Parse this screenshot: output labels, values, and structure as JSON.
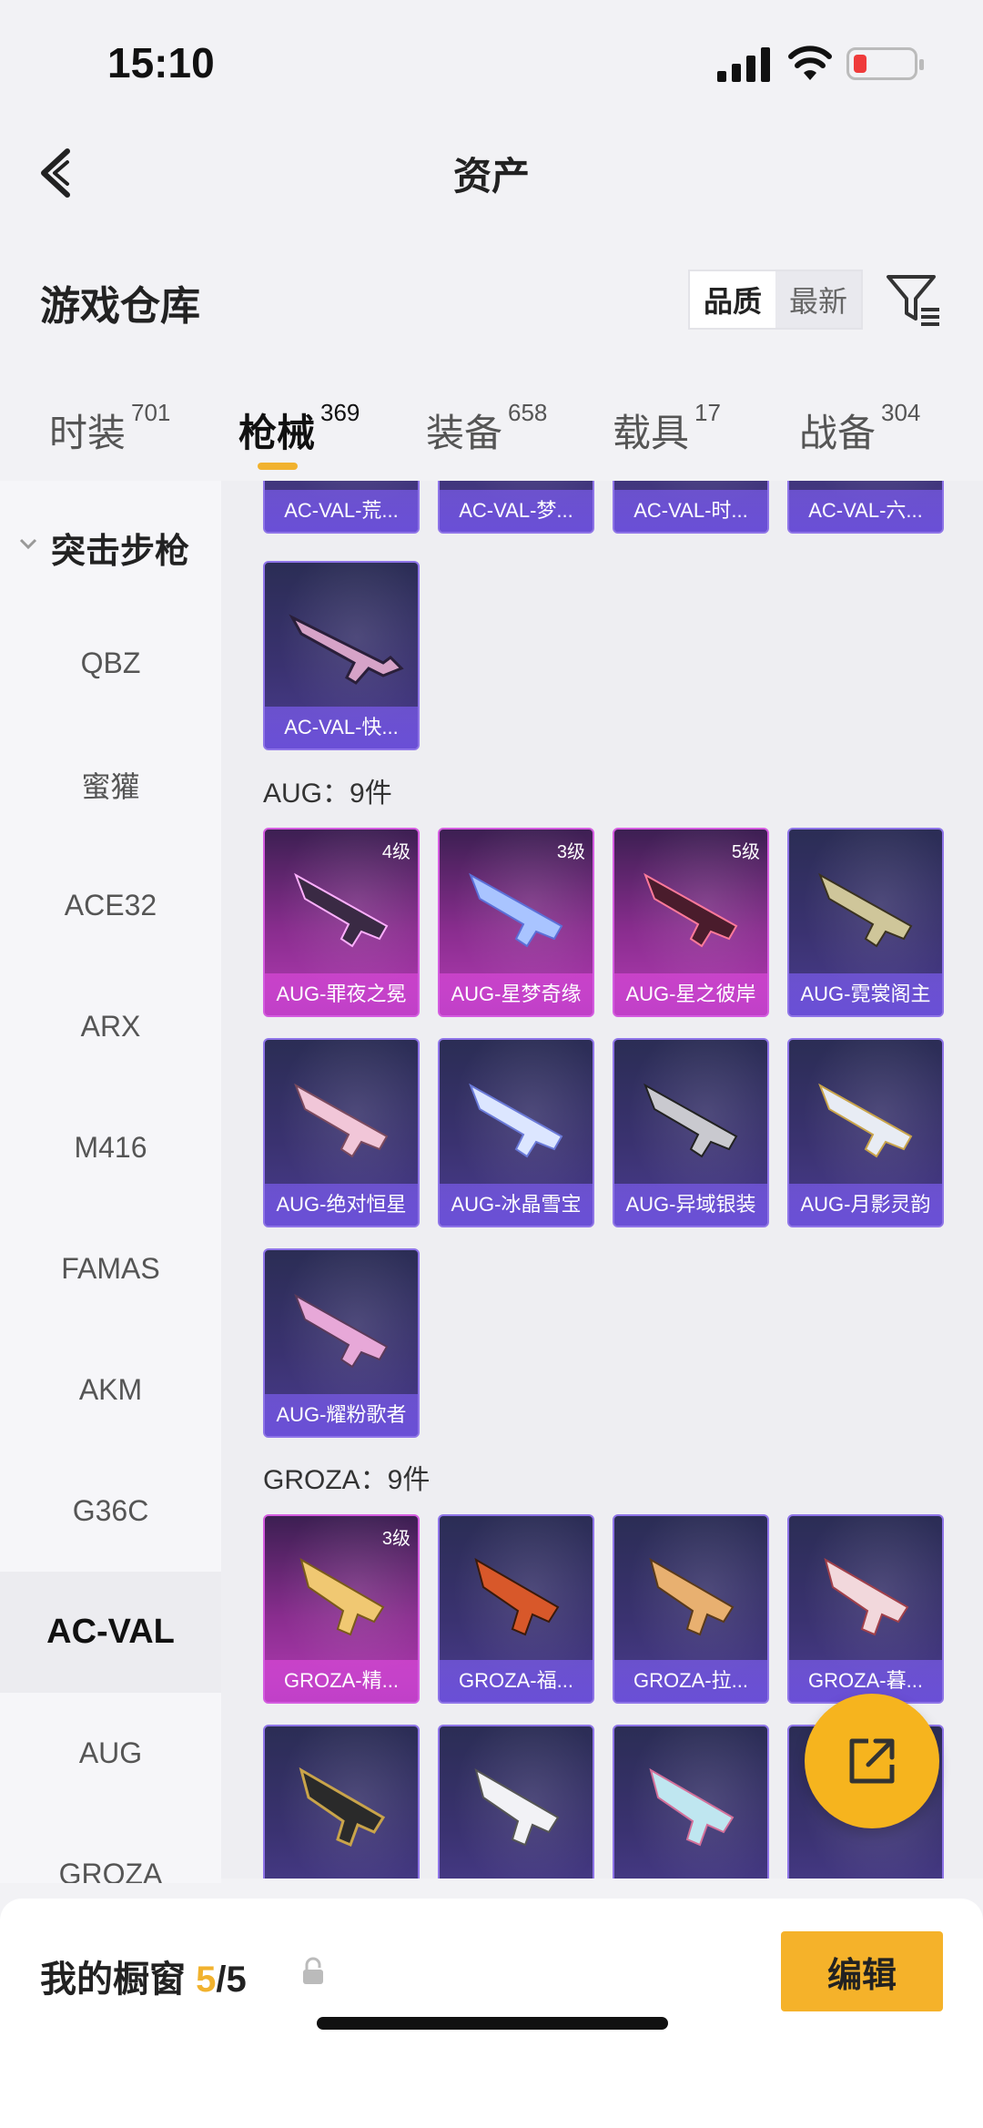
{
  "status_bar": {
    "time": "15:10"
  },
  "nav": {
    "title": "资产"
  },
  "warehouse": {
    "title": "游戏仓库",
    "sort_options": [
      "品质",
      "最新"
    ],
    "sort_selected": "品质"
  },
  "tabs": [
    {
      "label": "时装",
      "count": "701"
    },
    {
      "label": "枪械",
      "count": "369",
      "active": true
    },
    {
      "label": "装备",
      "count": "658"
    },
    {
      "label": "载具",
      "count": "17"
    },
    {
      "label": "战备",
      "count": "304"
    }
  ],
  "sidebar": {
    "category": "突击步枪",
    "items": [
      "QBZ",
      "蜜獾",
      "ACE32",
      "ARX",
      "M416",
      "FAMAS",
      "AKM",
      "G36C",
      "AC-VAL",
      "AUG",
      "GROZA"
    ],
    "selected": "AC-VAL"
  },
  "sections": {
    "acval": {
      "items": [
        {
          "name": "AC-VAL-荒..."
        },
        {
          "name": "AC-VAL-梦..."
        },
        {
          "name": "AC-VAL-时..."
        },
        {
          "name": "AC-VAL-六..."
        },
        {
          "name": "AC-VAL-快..."
        }
      ]
    },
    "aug": {
      "heading": "AUG：9件",
      "items": [
        {
          "name": "AUG-罪夜之冕",
          "level": "4级"
        },
        {
          "name": "AUG-星梦奇缘",
          "level": "3级"
        },
        {
          "name": "AUG-星之彼岸",
          "level": "5级"
        },
        {
          "name": "AUG-霓裳阁主"
        },
        {
          "name": "AUG-绝对恒星"
        },
        {
          "name": "AUG-冰晶雪宝"
        },
        {
          "name": "AUG-异域银装"
        },
        {
          "name": "AUG-月影灵韵"
        },
        {
          "name": "AUG-耀粉歌者"
        }
      ]
    },
    "groza": {
      "heading": "GROZA：9件",
      "items": [
        {
          "name": "GROZA-精...",
          "level": "3级"
        },
        {
          "name": "GROZA-福..."
        },
        {
          "name": "GROZA-拉..."
        },
        {
          "name": "GROZA-暮..."
        }
      ]
    }
  },
  "showcase": {
    "label": "我的橱窗",
    "current": "5",
    "total": "/5"
  },
  "edit_button": "编辑",
  "colors": {
    "accent": "#f5b22a",
    "card_purple": "#4a3c8e",
    "card_pink": "#b33cb4"
  }
}
